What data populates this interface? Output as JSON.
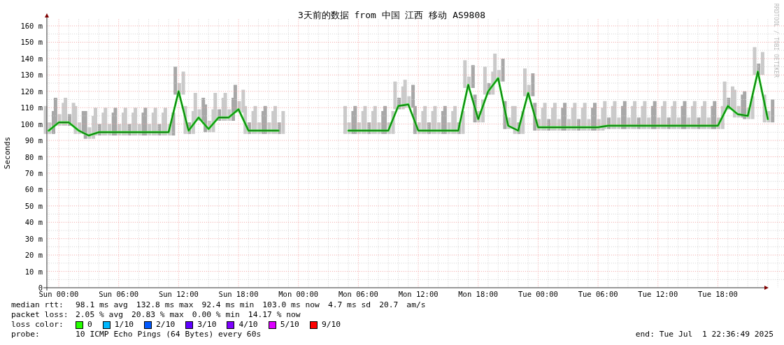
{
  "graph": {
    "title": "3天前的数据 from 中国 江西 移动 AS9808",
    "credit": "RRDTOOL / TOBI OETIKER",
    "chart_data": {
      "type": "line",
      "ylabel": "Seconds",
      "yticks": [
        {
          "value": 0,
          "label": "0"
        },
        {
          "value": 10,
          "label": "10 m"
        },
        {
          "value": 20,
          "label": "20 m"
        },
        {
          "value": 30,
          "label": "30 m"
        },
        {
          "value": 40,
          "label": "40 m"
        },
        {
          "value": 50,
          "label": "50 m"
        },
        {
          "value": 60,
          "label": "60 m"
        },
        {
          "value": 70,
          "label": "70 m"
        },
        {
          "value": 80,
          "label": "80 m"
        },
        {
          "value": 90,
          "label": "90 m"
        },
        {
          "value": 100,
          "label": "100 m"
        },
        {
          "value": 110,
          "label": "110 m"
        },
        {
          "value": 120,
          "label": "120 m"
        },
        {
          "value": 130,
          "label": "130 m"
        },
        {
          "value": 140,
          "label": "140 m"
        },
        {
          "value": 150,
          "label": "150 m"
        },
        {
          "value": 160,
          "label": "160 m"
        }
      ],
      "ylim": [
        0,
        164
      ],
      "grid": true,
      "categories": [
        null,
        "Sun 00:00",
        null,
        null,
        null,
        null,
        null,
        "Sun 06:00",
        null,
        null,
        null,
        null,
        null,
        "Sun 12:00",
        null,
        null,
        null,
        null,
        null,
        "Sun 18:00",
        null,
        null,
        null,
        null,
        null,
        "Mon 00:00",
        null,
        null,
        null,
        null,
        null,
        "Mon 06:00",
        null,
        null,
        null,
        null,
        null,
        "Mon 12:00",
        null,
        null,
        null,
        null,
        null,
        "Mon 18:00",
        null,
        null,
        null,
        null,
        null,
        "Tue 00:00",
        null,
        null,
        null,
        null,
        null,
        "Tue 06:00",
        null,
        null,
        null,
        null,
        null,
        "Tue 12:00",
        null,
        null,
        null,
        null,
        null,
        "Tue 18:00",
        null,
        null,
        null,
        null,
        null
      ],
      "series": [
        {
          "name": "median rtt:",
          "color": "#20e020",
          "values": [
            96,
            101,
            101,
            96,
            93,
            95,
            95,
            95,
            95,
            95,
            95,
            95,
            95,
            120,
            96,
            104,
            97,
            104,
            104,
            109,
            96,
            96,
            96,
            96,
            null,
            null,
            null,
            null,
            null,
            null,
            96,
            96,
            96,
            96,
            96,
            111,
            112,
            96,
            96,
            96,
            96,
            96,
            124,
            103,
            120,
            128,
            99,
            96,
            119,
            98,
            98,
            98,
            98,
            98,
            98,
            98,
            99,
            99,
            99,
            99,
            99,
            99,
            99,
            99,
            99,
            99,
            99,
            99,
            111,
            106,
            105,
            132,
            103
          ]
        }
      ]
    }
  },
  "legend": {
    "median_rtt": {
      "values": [
        "98.1 ms avg",
        "132.8 ms max",
        "92.4 ms min",
        "103.0 ms now",
        "4.7 ms sd",
        "20.7",
        "am/s"
      ]
    },
    "packet_loss": {
      "label": "packet loss:",
      "values": [
        "2.05 % avg",
        "20.83 % max",
        "0.00 % min",
        "14.17 % now"
      ]
    },
    "loss_color": {
      "label": "loss color:",
      "items": [
        {
          "label": "0",
          "color": "#26ff00"
        },
        {
          "label": "1/10",
          "color": "#00b8ff"
        },
        {
          "label": "2/10",
          "color": "#0059ff"
        },
        {
          "label": "3/10",
          "color": "#5e00ff"
        },
        {
          "label": "4/10",
          "color": "#7e00ff"
        },
        {
          "label": "5/10",
          "color": "#dd00ff"
        },
        {
          "label": "9/10",
          "color": "#ff0000"
        }
      ]
    },
    "probe": {
      "label": "probe:",
      "value": "10 ICMP Echo Pings (64 Bytes) every 60s"
    },
    "end": "end: Tue Jul  1 22:36:49 2025"
  }
}
